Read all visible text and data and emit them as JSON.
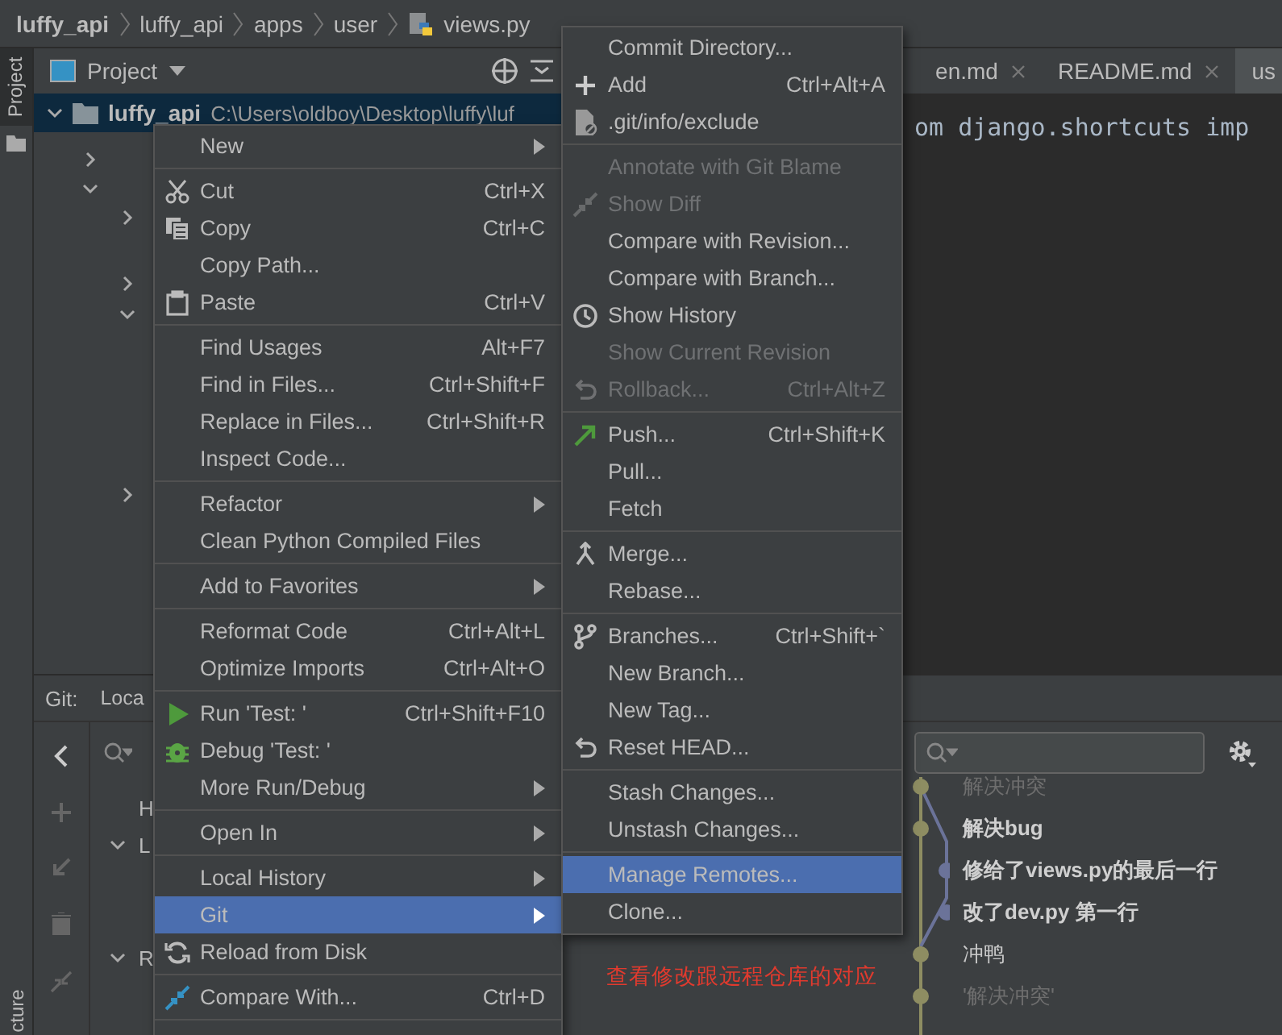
{
  "breadcrumb": [
    {
      "label": "luffy_api"
    },
    {
      "label": "luffy_api"
    },
    {
      "label": "apps"
    },
    {
      "label": "user"
    },
    {
      "label": "views.py",
      "kind": "file"
    }
  ],
  "side_strip": {
    "top_tab": {
      "label": "Project",
      "selected": true
    },
    "bottom_tab": {
      "label": "cture",
      "selected": false
    }
  },
  "project_panel": {
    "title": "Project",
    "root": {
      "label": "luffy_api",
      "path": "C:\\Users\\oldboy\\Desktop\\luffy\\luf",
      "expanded": true,
      "selected": true
    }
  },
  "editor": {
    "tabs": [
      {
        "label": "en.md",
        "selected": false
      },
      {
        "label": "README.md",
        "selected": false
      },
      {
        "label": "us",
        "selected": true
      }
    ],
    "code_line": "om django.shortcuts imp"
  },
  "git_panel": {
    "title": "Git:",
    "tab": "Loca",
    "tree": [
      {
        "label": "H",
        "expanded": false
      },
      {
        "label": "L",
        "expanded": true
      },
      {
        "label": "R",
        "expanded": true
      }
    ],
    "commits": [
      {
        "message": "解决冲突",
        "kind": "faint",
        "side_lane": false
      },
      {
        "message": "解决bug",
        "kind": "bold",
        "side_lane": false
      },
      {
        "message": "修给了views.py的最后一行",
        "kind": "bold",
        "side_lane": true
      },
      {
        "message": "改了dev.py 第一行",
        "kind": "bold",
        "side_lane": true
      },
      {
        "message": "冲鸭",
        "kind": "normal",
        "side_lane": false
      },
      {
        "message": "'解决冲突'",
        "kind": "faint",
        "side_lane": false
      }
    ]
  },
  "context_menu": {
    "items": [
      {
        "kind": "item",
        "label": "New",
        "submenu": true,
        "selected": false
      },
      {
        "kind": "separator"
      },
      {
        "kind": "item",
        "label": "Cut",
        "shortcut": "Ctrl+X",
        "submenu": false,
        "selected": false
      },
      {
        "kind": "item",
        "label": "Copy",
        "shortcut": "Ctrl+C",
        "submenu": false,
        "selected": false
      },
      {
        "kind": "item",
        "label": "Copy Path...",
        "submenu": false,
        "selected": false
      },
      {
        "kind": "item",
        "label": "Paste",
        "shortcut": "Ctrl+V",
        "submenu": false,
        "selected": false
      },
      {
        "kind": "separator"
      },
      {
        "kind": "item",
        "label": "Find Usages",
        "shortcut": "Alt+F7",
        "submenu": false,
        "selected": false
      },
      {
        "kind": "item",
        "label": "Find in Files...",
        "shortcut": "Ctrl+Shift+F",
        "submenu": false,
        "selected": false
      },
      {
        "kind": "item",
        "label": "Replace in Files...",
        "shortcut": "Ctrl+Shift+R",
        "submenu": false,
        "selected": false
      },
      {
        "kind": "item",
        "label": "Inspect Code...",
        "submenu": false,
        "selected": false
      },
      {
        "kind": "separator"
      },
      {
        "kind": "item",
        "label": "Refactor",
        "submenu": true,
        "selected": false
      },
      {
        "kind": "item",
        "label": "Clean Python Compiled Files",
        "submenu": false,
        "selected": false
      },
      {
        "kind": "separator"
      },
      {
        "kind": "item",
        "label": "Add to Favorites",
        "submenu": true,
        "selected": false
      },
      {
        "kind": "separator"
      },
      {
        "kind": "item",
        "label": "Reformat Code",
        "shortcut": "Ctrl+Alt+L",
        "submenu": false,
        "selected": false
      },
      {
        "kind": "item",
        "label": "Optimize Imports",
        "shortcut": "Ctrl+Alt+O",
        "submenu": false,
        "selected": false
      },
      {
        "kind": "separator"
      },
      {
        "kind": "item",
        "label": "Run 'Test: '",
        "shortcut": "Ctrl+Shift+F10",
        "submenu": false,
        "selected": false
      },
      {
        "kind": "item",
        "label": "Debug 'Test: '",
        "submenu": false,
        "selected": false
      },
      {
        "kind": "item",
        "label": "More Run/Debug",
        "submenu": true,
        "selected": false
      },
      {
        "kind": "separator"
      },
      {
        "kind": "item",
        "label": "Open In",
        "submenu": true,
        "selected": false
      },
      {
        "kind": "separator"
      },
      {
        "kind": "item",
        "label": "Local History",
        "submenu": true,
        "selected": false
      },
      {
        "kind": "item",
        "label": "Git",
        "submenu": true,
        "selected": true
      },
      {
        "kind": "item",
        "label": "Reload from Disk",
        "submenu": false,
        "selected": false
      },
      {
        "kind": "separator"
      },
      {
        "kind": "item",
        "label": "Compare With...",
        "shortcut": "Ctrl+D",
        "submenu": false,
        "selected": false
      },
      {
        "kind": "separator"
      }
    ]
  },
  "git_menu": {
    "items": [
      {
        "kind": "item",
        "label": "Commit Directory...",
        "disabled": false,
        "selected": false
      },
      {
        "kind": "item",
        "label": "Add",
        "shortcut": "Ctrl+Alt+A",
        "disabled": false,
        "selected": false
      },
      {
        "kind": "item",
        "label": ".git/info/exclude",
        "disabled": false,
        "selected": false
      },
      {
        "kind": "separator"
      },
      {
        "kind": "item",
        "label": "Annotate with Git Blame",
        "disabled": true,
        "selected": false
      },
      {
        "kind": "item",
        "label": "Show Diff",
        "disabled": true,
        "selected": false
      },
      {
        "kind": "item",
        "label": "Compare with Revision...",
        "disabled": false,
        "selected": false
      },
      {
        "kind": "item",
        "label": "Compare with Branch...",
        "disabled": false,
        "selected": false
      },
      {
        "kind": "item",
        "label": "Show History",
        "disabled": false,
        "selected": false
      },
      {
        "kind": "item",
        "label": "Show Current Revision",
        "disabled": true,
        "selected": false
      },
      {
        "kind": "item",
        "label": "Rollback...",
        "shortcut": "Ctrl+Alt+Z",
        "disabled": true,
        "selected": false
      },
      {
        "kind": "separator"
      },
      {
        "kind": "item",
        "label": "Push...",
        "shortcut": "Ctrl+Shift+K",
        "disabled": false,
        "selected": false
      },
      {
        "kind": "item",
        "label": "Pull...",
        "disabled": false,
        "selected": false
      },
      {
        "kind": "item",
        "label": "Fetch",
        "disabled": false,
        "selected": false
      },
      {
        "kind": "separator"
      },
      {
        "kind": "item",
        "label": "Merge...",
        "disabled": false,
        "selected": false
      },
      {
        "kind": "item",
        "label": "Rebase...",
        "disabled": false,
        "selected": false
      },
      {
        "kind": "separator"
      },
      {
        "kind": "item",
        "label": "Branches...",
        "shortcut": "Ctrl+Shift+`",
        "disabled": false,
        "selected": false
      },
      {
        "kind": "item",
        "label": "New Branch...",
        "disabled": false,
        "selected": false
      },
      {
        "kind": "item",
        "label": "New Tag...",
        "disabled": false,
        "selected": false
      },
      {
        "kind": "item",
        "label": "Reset HEAD...",
        "disabled": false,
        "selected": false
      },
      {
        "kind": "separator"
      },
      {
        "kind": "item",
        "label": "Stash Changes...",
        "disabled": false,
        "selected": false
      },
      {
        "kind": "item",
        "label": "Unstash Changes...",
        "disabled": false,
        "selected": false
      },
      {
        "kind": "separator"
      },
      {
        "kind": "item",
        "label": "Manage Remotes...",
        "disabled": false,
        "selected": true
      },
      {
        "kind": "item",
        "label": "Clone...",
        "disabled": false,
        "selected": false
      }
    ]
  },
  "annotation": "查看修改跟远程仓库的对应"
}
